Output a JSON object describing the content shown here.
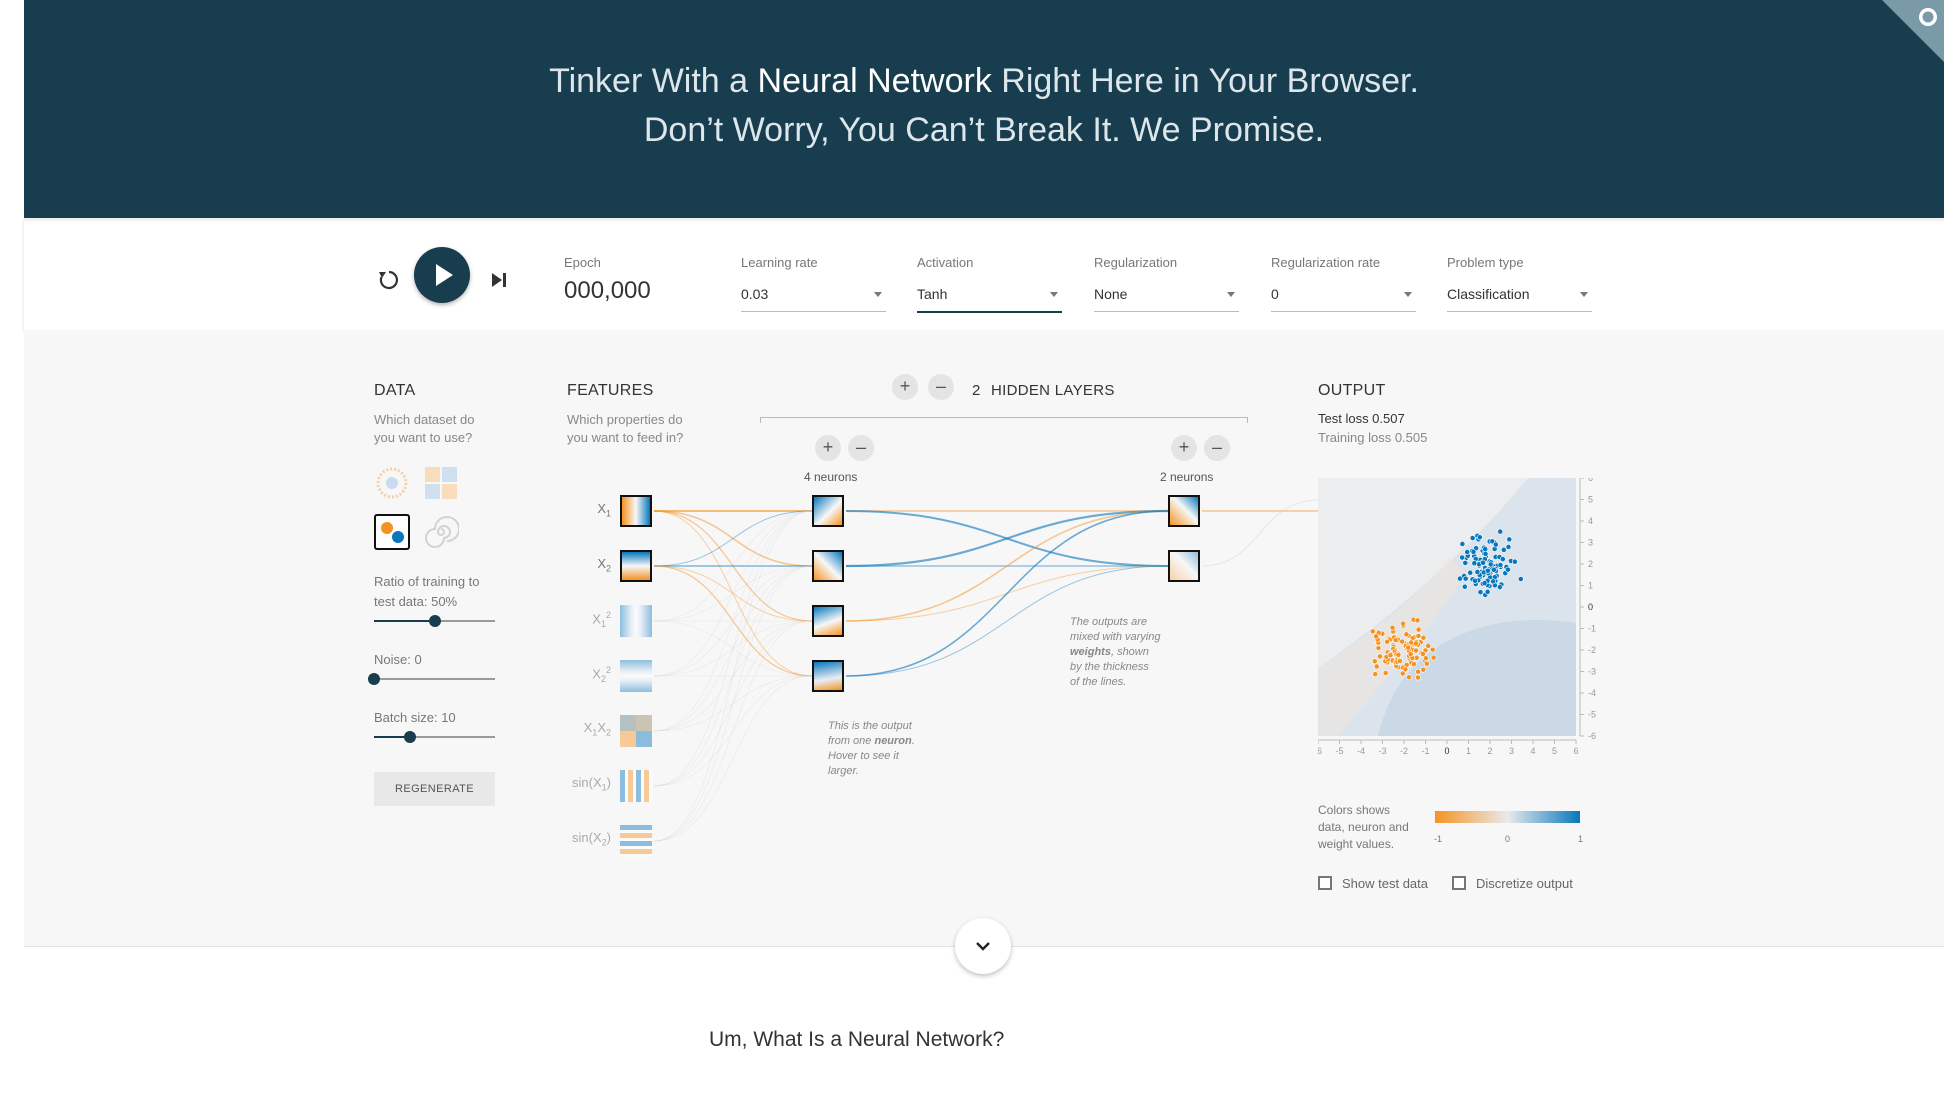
{
  "header": {
    "line1_pre": "Tinker With a ",
    "line1_bold": "Neural Network",
    "line1_post": " Right Here in Your Browser.",
    "line2": "Don’t Worry, You Can’t Break It. We Promise."
  },
  "controls": {
    "epoch_label": "Epoch",
    "epoch_value": "000,000",
    "learning_rate": {
      "label": "Learning rate",
      "value": "0.03"
    },
    "activation": {
      "label": "Activation",
      "value": "Tanh"
    },
    "regularization": {
      "label": "Regularization",
      "value": "None"
    },
    "regularization_rate": {
      "label": "Regularization rate",
      "value": "0"
    },
    "problem_type": {
      "label": "Problem type",
      "value": "Classification"
    }
  },
  "data_panel": {
    "title": "DATA",
    "desc1": "Which dataset do",
    "desc2": "you want to use?",
    "ratio_label1": "Ratio of training to",
    "ratio_label2": "test data:  50%",
    "ratio_value": 0.5,
    "noise_label": "Noise:  0",
    "noise_value": 0,
    "batch_label": "Batch size:  10",
    "batch_value": 0.3,
    "regenerate": "REGENERATE"
  },
  "features_panel": {
    "title": "FEATURES",
    "desc1": "Which properties do",
    "desc2": "you want to feed in?",
    "features": [
      {
        "base": "X",
        "sub": "1",
        "sup": ""
      },
      {
        "base": "X",
        "sub": "2",
        "sup": ""
      },
      {
        "base": "X",
        "sub": "1",
        "sup": "2"
      },
      {
        "base": "X",
        "sub": "2",
        "sup": "2"
      },
      {
        "base": "X",
        "sub": "1",
        "base2": "X",
        "sub2": "2"
      },
      {
        "base": "sin(X",
        "sub": "1",
        "post": ")"
      },
      {
        "base": "sin(X",
        "sub": "2",
        "post": ")"
      }
    ]
  },
  "network": {
    "hidden_count": "2",
    "hidden_label": "HIDDEN LAYERS",
    "layer1_neurons": "4 neurons",
    "layer2_neurons": "2 neurons",
    "note1": [
      "This is the output",
      "from one ",
      "neuron",
      ".",
      "Hover to see it",
      "larger."
    ],
    "note2": [
      "The outputs are",
      "mixed with varying",
      "weights",
      ", shown",
      "by the thickness",
      "of the lines."
    ]
  },
  "output_panel": {
    "title": "OUTPUT",
    "test_loss": "Test loss 0.507",
    "training_loss": "Training loss 0.505",
    "x_ticks": [
      "-6",
      "-5",
      "-4",
      "-3",
      "-2",
      "-1",
      "0",
      "1",
      "2",
      "3",
      "4",
      "5",
      "6"
    ],
    "y_ticks": [
      "6",
      "5",
      "4",
      "3",
      "2",
      "1",
      "0",
      "-1",
      "-2",
      "-3",
      "-4",
      "-5",
      "-6"
    ],
    "legend_text1": "Colors shows",
    "legend_text2": "data, neuron and",
    "legend_text3": "weight values.",
    "legend_min": "-1",
    "legend_mid": "0",
    "legend_max": "1",
    "show_test_data": "Show test data",
    "discretize_output": "Discretize output"
  },
  "colors": {
    "header_bg": "#183d4e",
    "orange": "#f59322",
    "blue": "#0877bd"
  },
  "article": {
    "title": "Um, What Is a Neural Network?"
  }
}
